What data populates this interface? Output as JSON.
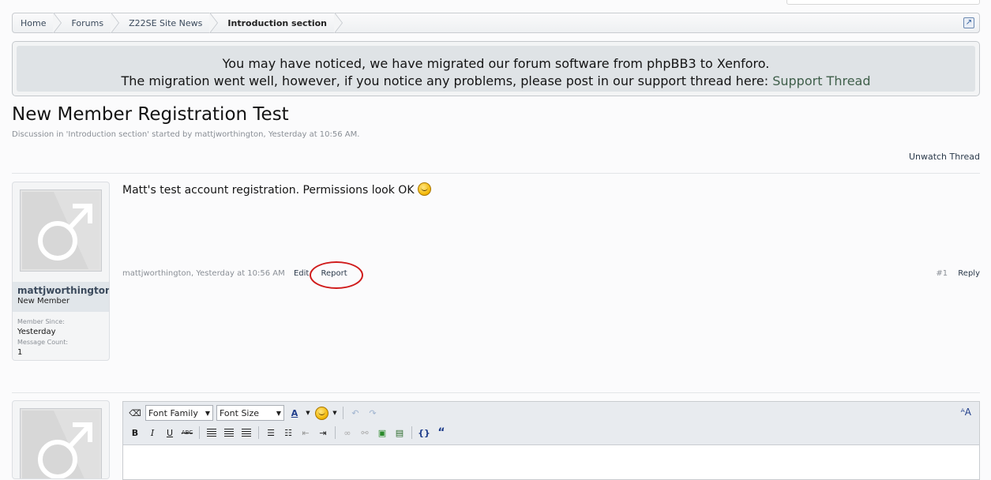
{
  "breadcrumb": {
    "items": [
      "Home",
      "Forums",
      "Z22SE Site News"
    ],
    "current": "Introduction section"
  },
  "notice": {
    "line1": "You may have noticed, we have migrated our forum software from phpBB3 to Xenforo.",
    "line2": "The migration went well, however, if you notice any problems, please post in our support thread here:",
    "link": "Support Thread"
  },
  "thread": {
    "title": "New Member Registration Test",
    "meta": "Discussion in 'Introduction section' started by mattjworthington, Yesterday at 10:56 AM.",
    "unwatch": "Unwatch Thread"
  },
  "post": {
    "username": "mattjworthington",
    "usertitle": "New Member",
    "member_since_label": "Member Since:",
    "member_since": "Yesterday",
    "message_count_label": "Message Count:",
    "message_count": "1",
    "message": "Matt's test account registration. Permissions look OK",
    "footer_meta": "mattjworthington, Yesterday at 10:56 AM",
    "edit": "Edit",
    "report": "Report",
    "number": "#1",
    "reply": "Reply"
  },
  "editor": {
    "font_family": "Font Family",
    "font_size": "Font Size"
  }
}
